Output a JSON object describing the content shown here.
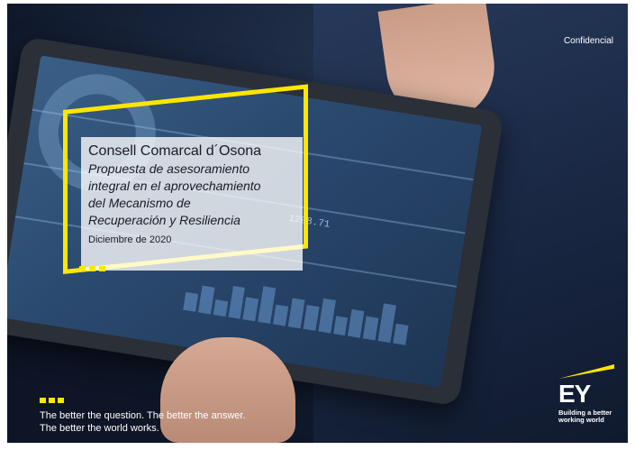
{
  "header": {
    "confidential_label": "Confidencial"
  },
  "cover": {
    "title": "Consell Comarcal d´Osona",
    "subtitle_lines": [
      "Propuesta de asesoramiento",
      "integral en el aprovechamiento",
      "del Mecanismo de",
      "Recuperación y Resiliencia"
    ],
    "date": "Diciembre de 2020"
  },
  "footer": {
    "tagline_lines": [
      "The better the question. The better the answer.",
      "The better the world works."
    ]
  },
  "brand": {
    "logo_text": "EY",
    "claim_lines": [
      "Building a better",
      "working world"
    ],
    "accent_color": "#ffe600"
  },
  "screen_ticker": [
    "1208.71"
  ]
}
